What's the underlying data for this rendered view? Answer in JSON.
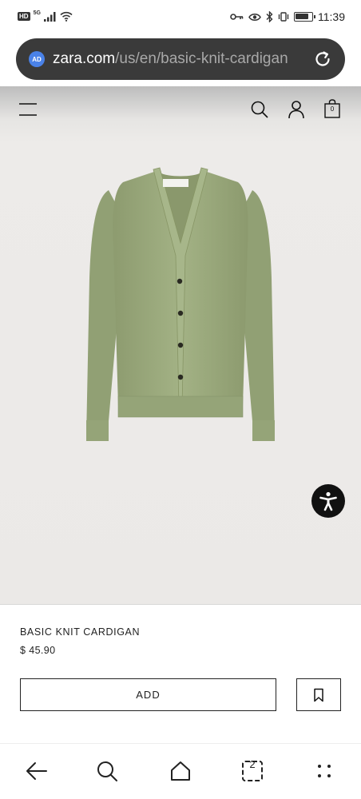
{
  "status_bar": {
    "hd": "HD",
    "network": "5G",
    "time": "11:39",
    "battery_level": 0.85,
    "icons": [
      "hd-icon",
      "signal-icon",
      "wifi-icon",
      "key-icon",
      "eye-icon",
      "bluetooth-icon",
      "vibrate-icon",
      "battery-icon"
    ]
  },
  "browser": {
    "site_icon_text": "AD",
    "url_domain": "zara.com",
    "url_path": "/us/en/basic-knit-cardigan",
    "reload_icon": "reload-icon",
    "toolbar": {
      "back_icon": "back-arrow-icon",
      "search_icon": "search-icon",
      "home_icon": "home-icon",
      "tabs_count": "2",
      "menu_icon": "more-dots-icon"
    }
  },
  "site_header": {
    "menu_icon": "hamburger-menu-icon",
    "search_icon": "search-icon",
    "account_icon": "account-icon",
    "bag_icon": "shopping-bag-icon",
    "bag_count": "0"
  },
  "product": {
    "name": "BASIC KNIT CARDIGAN",
    "price": "$ 45.90",
    "image_icon": "cardigan-image",
    "color": "#9cab7e"
  },
  "actions": {
    "add_label": "ADD",
    "bookmark_icon": "bookmark-icon"
  },
  "accessibility_icon": "accessibility-icon"
}
